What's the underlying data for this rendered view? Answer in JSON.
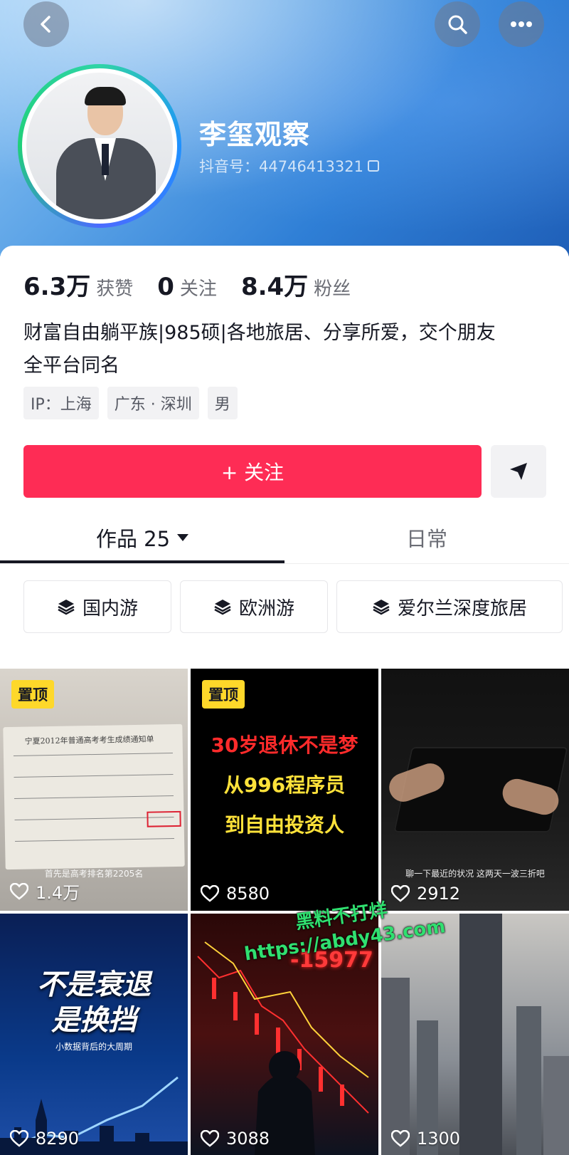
{
  "header": {
    "name": "李玺观察",
    "douyin_id": "抖音号：44746413321"
  },
  "stats": [
    {
      "num": "6.3万",
      "label": "获赞"
    },
    {
      "num": "0",
      "label": "关注"
    },
    {
      "num": "8.4万",
      "label": "粉丝"
    }
  ],
  "bio": {
    "line1": "财富自由躺平族|985硕|各地旅居、分享所爱，交个朋友",
    "line2": "全平台同名"
  },
  "tags": [
    "IP：上海",
    "广东 · 深圳",
    "男"
  ],
  "follow_button": "+ 关注",
  "tabs": {
    "works": "作品 25",
    "daily": "日常"
  },
  "collections": [
    "国内游",
    "欧洲游",
    "爱尔兰深度旅居"
  ],
  "videos": [
    {
      "pinned": "置顶",
      "likes": "1.4万",
      "caption": "首先是高考排名第2205名",
      "paper_title": "宁夏2012年普通高考考生成绩通知单"
    },
    {
      "pinned": "置顶",
      "likes": "8580",
      "lines": [
        "30岁退休不是梦",
        "从996程序员",
        "到自由投资人"
      ]
    },
    {
      "likes": "2912",
      "caption": "聊一下最近的状况 这两天一波三折吧"
    },
    {
      "likes": "8290",
      "title_lines": [
        "不是衰退",
        "是换挡"
      ],
      "subtitle": "小数据背后的大周期"
    },
    {
      "likes": "3088",
      "overlay_number": "-15977"
    },
    {
      "likes": "1300"
    }
  ],
  "watermark": {
    "line1": "黑料不打烊",
    "line2": "https://abdy43.com"
  },
  "colors": {
    "accent": "#fe2c55",
    "pin": "#fed82a"
  }
}
